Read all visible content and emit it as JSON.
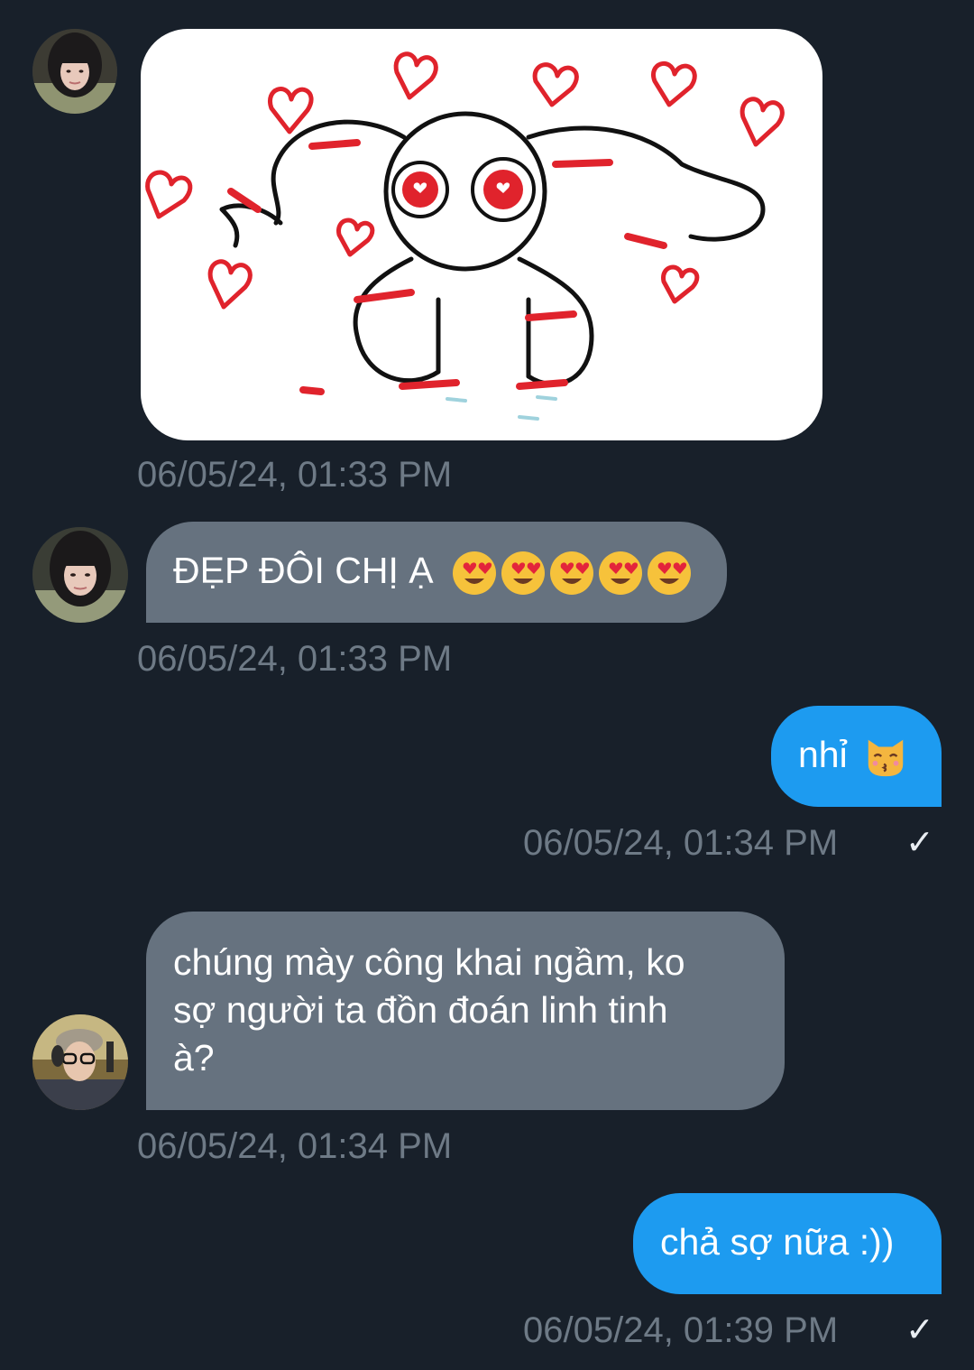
{
  "messages": [
    {
      "sender": "contact",
      "type": "image",
      "image_description": "red-and-white doodle creature with heart eyes surrounded by hearts",
      "timestamp": "06/05/24, 01:33 PM"
    },
    {
      "sender": "contact",
      "type": "text",
      "text": "ĐẸP ĐÔI CHỊ Ạ",
      "emoji": "😍😍😍😍😍",
      "timestamp": "06/05/24, 01:33 PM"
    },
    {
      "sender": "me",
      "type": "text",
      "text": "nhỉ",
      "emoji": "😽",
      "timestamp": "06/05/24, 01:34 PM",
      "status_icon": "check-icon"
    },
    {
      "sender": "contact2",
      "type": "text",
      "lines": [
        "chúng mày công khai ngầm, ko",
        "sợ người ta đồn đoán linh tinh",
        "à?"
      ],
      "timestamp": "06/05/24, 01:34 PM"
    },
    {
      "sender": "me",
      "type": "text",
      "text": "chả sợ nữa :))",
      "timestamp": "06/05/24, 01:39 PM",
      "status_icon": "check-icon"
    }
  ],
  "colors": {
    "background": "#18202a",
    "incoming_bubble": "#66727f",
    "outgoing_bubble": "#1d9bf0",
    "timestamp": "#6e7a86"
  }
}
